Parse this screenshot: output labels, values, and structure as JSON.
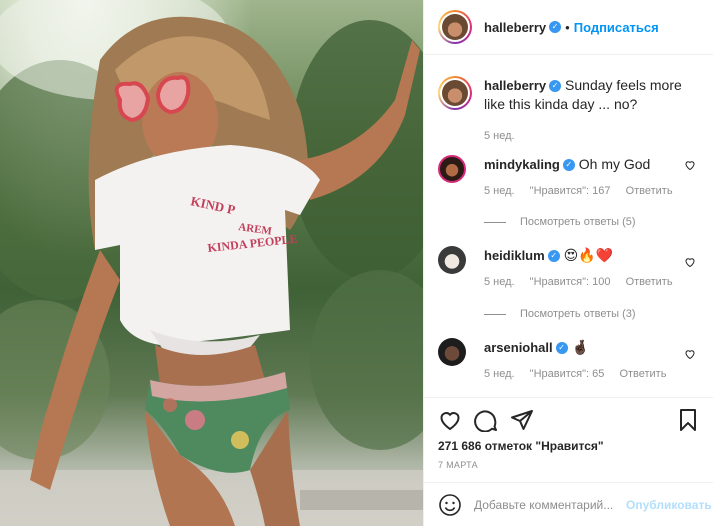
{
  "header": {
    "username": "halleberry",
    "separator": "•",
    "follow_label": "Подписаться"
  },
  "caption": {
    "username": "halleberry",
    "text": "Sunday feels more like this kinda day ... no?",
    "time": "5 нед."
  },
  "photo": {
    "shirt_text_line1": "KIND P",
    "shirt_text_line2": "AREM",
    "shirt_text_line3": "KINDA PEOPLE"
  },
  "comments": [
    {
      "username": "mindykaling",
      "text": "Oh my God",
      "time": "5 нед.",
      "likes": "\"Нравится\": 167",
      "reply": "Ответить",
      "view_replies": "Посмотреть ответы (5)"
    },
    {
      "username": "heidiklum",
      "text": "😍🔥❤️",
      "time": "5 нед.",
      "likes": "\"Нравится\": 100",
      "reply": "Ответить",
      "view_replies": "Посмотреть ответы (3)"
    },
    {
      "username": "arseniohall",
      "text": "🤞🏿",
      "time": "5 нед.",
      "likes": "\"Нравится\": 65",
      "reply": "Ответить"
    }
  ],
  "actions": {
    "likes_count": "271 686 отметок \"Нравится\"",
    "date": "7 МАРТА",
    "icons": [
      "heart-icon",
      "comment-icon",
      "share-icon",
      "bookmark-icon"
    ]
  },
  "add_comment": {
    "placeholder": "Добавьте комментарий...",
    "publish_label": "Опубликовать",
    "emoji_icon": "smiley-icon"
  },
  "colors": {
    "link_blue": "#0095f6",
    "verified_blue": "#3897f0",
    "muted_gray": "#8e8e8e",
    "publish_disabled": "#b2dffc"
  }
}
